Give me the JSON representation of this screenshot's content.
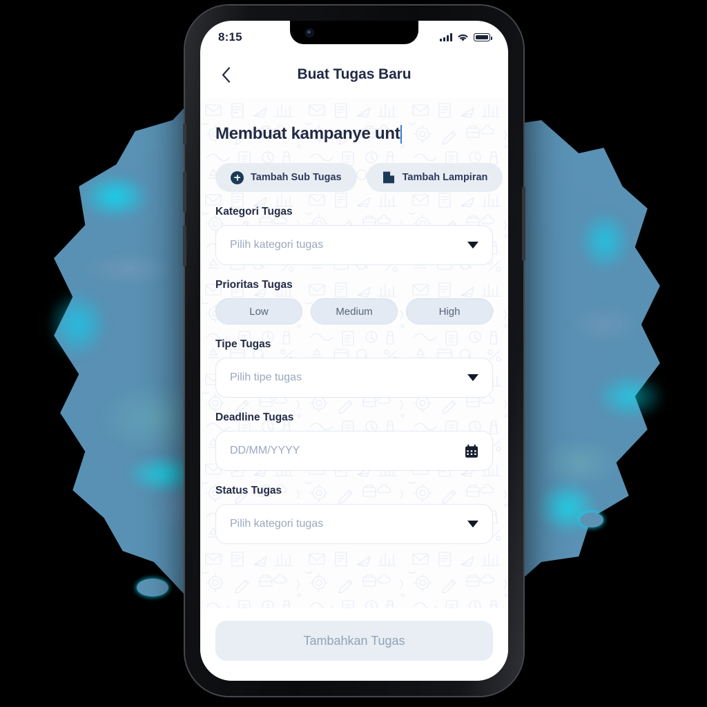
{
  "status_bar": {
    "time": "8:15",
    "signal_icon": "signal-bars-icon",
    "wifi_icon": "wifi-icon",
    "battery_icon": "battery-icon"
  },
  "header": {
    "back_icon": "chevron-left-icon",
    "title": "Buat Tugas Baru"
  },
  "task_title_input": {
    "value": "Membuat kampanye unt",
    "has_caret": true,
    "caret_color": "#3a7bd5"
  },
  "actions": [
    {
      "label": "Tambah Sub Tugas",
      "icon": "plus-circle-icon"
    },
    {
      "label": "Tambah Lampiran",
      "icon": "file-attachment-icon"
    }
  ],
  "fields": {
    "category": {
      "label": "Kategori Tugas",
      "placeholder": "Pilih kategori tugas",
      "icon": "chevron-down-icon"
    },
    "priority": {
      "label": "Prioritas Tugas",
      "options": [
        "Low",
        "Medium",
        "High"
      ],
      "selected": null
    },
    "type": {
      "label": "Tipe Tugas",
      "placeholder": "Pilih tipe tugas",
      "icon": "chevron-down-icon"
    },
    "deadline": {
      "label": "Deadline Tugas",
      "placeholder": "DD/MM/YYYY",
      "icon": "calendar-icon"
    },
    "status": {
      "label": "Status Tugas",
      "placeholder": "Pilih kategori tugas",
      "icon": "chevron-down-icon"
    }
  },
  "footer": {
    "submit_label": "Tambahkan Tugas",
    "submit_enabled": false
  },
  "colors": {
    "accent_dark": "#1b3a57",
    "text_primary": "#222b45",
    "placeholder": "#9aa7bd",
    "pill_bg": "#e8edf4",
    "background_blob": "#5b93b5",
    "backdrop": "#000000"
  }
}
